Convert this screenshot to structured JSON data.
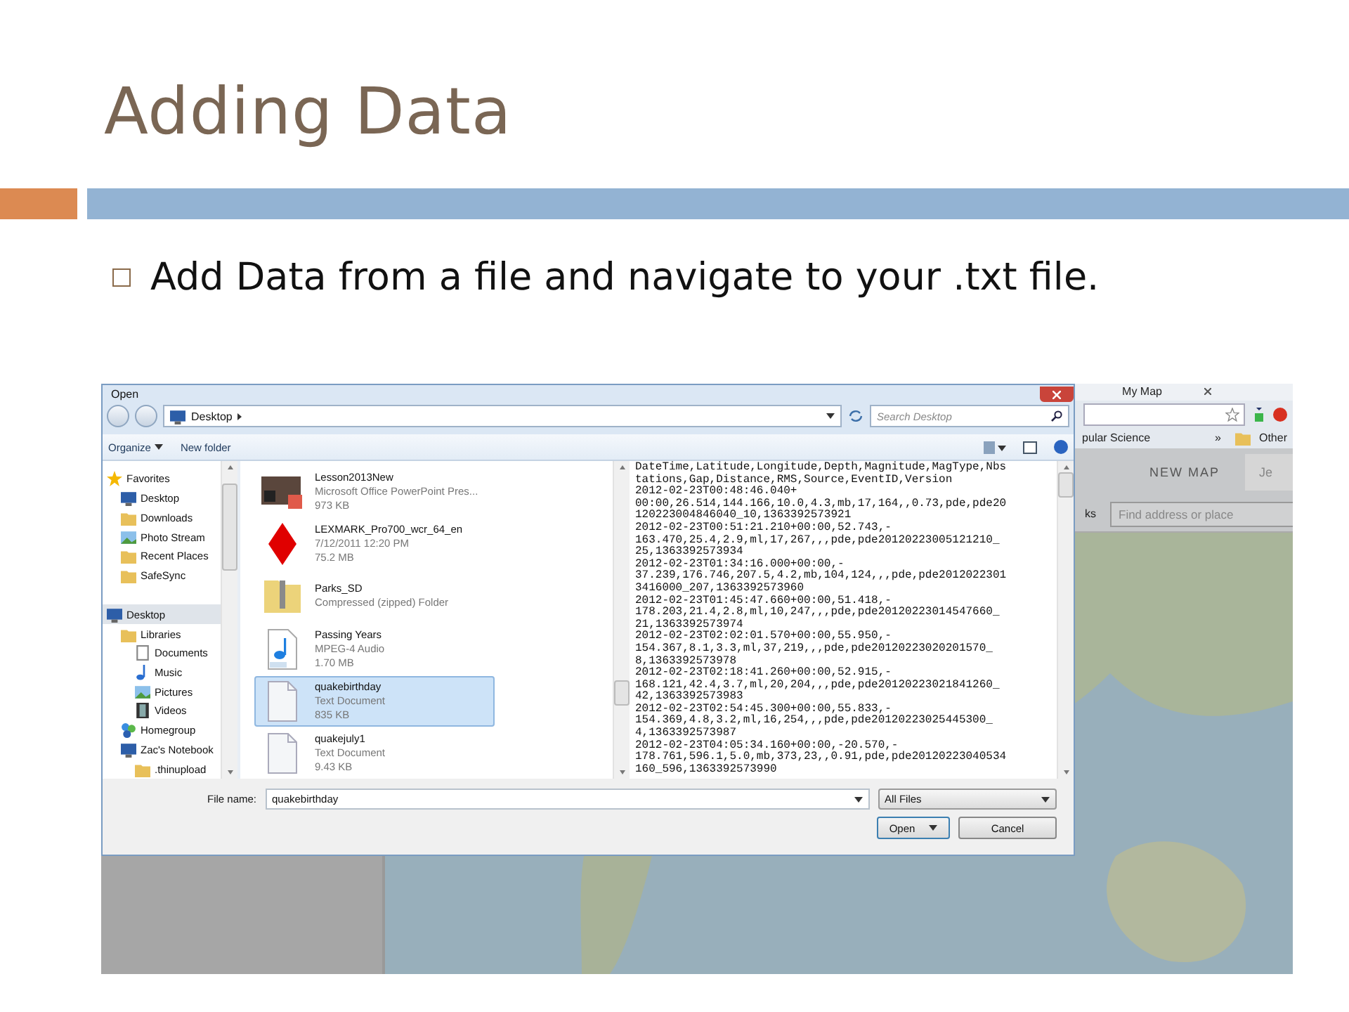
{
  "slide": {
    "title": "Adding Data",
    "bullet": "Add Data from a file and navigate to your .txt file."
  },
  "browser": {
    "tab_title": "My Map",
    "bookmarks": [
      {
        "label": "pular Science",
        "kind": "link"
      },
      {
        "label": "»",
        "kind": "more"
      },
      {
        "label": "Other",
        "kind": "folder"
      }
    ],
    "new_map": "NEW MAP",
    "user_tab": "Je",
    "nav_fragment": "ks",
    "search": {
      "placeholder": "Find address or place"
    }
  },
  "dialog": {
    "title": "Open",
    "breadcrumb": "Desktop",
    "search": {
      "placeholder": "Search Desktop"
    },
    "toolbar": [
      {
        "label": "Organize",
        "has_menu": true
      },
      {
        "label": "New folder",
        "has_menu": false
      }
    ],
    "nav": [
      {
        "label": "Favorites",
        "kind": "star",
        "selected": false,
        "children": [
          {
            "label": "Desktop",
            "kind": "monitor",
            "selected": false
          },
          {
            "label": "Downloads",
            "kind": "folder",
            "selected": false
          },
          {
            "label": "Photo Stream",
            "kind": "picture",
            "selected": false
          },
          {
            "label": "Recent Places",
            "kind": "folder",
            "selected": false
          },
          {
            "label": "SafeSync",
            "kind": "folder",
            "selected": false
          }
        ]
      },
      {
        "label": "Desktop",
        "kind": "monitor",
        "selected": true,
        "children": [
          {
            "label": "Libraries",
            "kind": "folder",
            "selected": false,
            "children": [
              {
                "label": "Documents",
                "kind": "document",
                "selected": false
              },
              {
                "label": "Music",
                "kind": "note",
                "selected": false
              },
              {
                "label": "Pictures",
                "kind": "picture",
                "selected": false
              },
              {
                "label": "Videos",
                "kind": "film",
                "selected": false
              }
            ]
          },
          {
            "label": "Homegroup",
            "kind": "people",
            "selected": false
          },
          {
            "label": "Zac's Notebook",
            "kind": "computer",
            "selected": false,
            "children": [
              {
                "label": ".thinupload",
                "kind": "folder",
                "selected": false
              }
            ]
          }
        ]
      }
    ],
    "files": [
      {
        "name": "Lesson2013New",
        "line2": "Microsoft Office PowerPoint Pres...",
        "line3": "973 KB",
        "kind": "slides",
        "selected": false
      },
      {
        "name": "LEXMARK_Pro700_wcr_64_en",
        "line2": "7/12/2011 12:20 PM",
        "line3": "75.2 MB",
        "kind": "diamond",
        "selected": false
      },
      {
        "name": "Parks_SD",
        "line2": "Compressed (zipped) Folder",
        "kind": "zip",
        "selected": false
      },
      {
        "name": "Passing Years",
        "line2": "MPEG-4 Audio",
        "line3": "1.70 MB",
        "kind": "audio",
        "selected": false
      },
      {
        "name": "quakebirthday",
        "line2": "Text Document",
        "line3": "835 KB",
        "kind": "text",
        "selected": true
      },
      {
        "name": "quakejuly1",
        "line2": "Text Document",
        "line3": "9.43 KB",
        "kind": "text",
        "selected": false
      }
    ],
    "preview": [
      "DateTime,Latitude,Longitude,Depth,Magnitude,MagType,Nbs",
      "tations,Gap,Distance,RMS,Source,EventID,Version",
      "2012-02-23T00:48:46.040+",
      "00:00,26.514,144.166,10.0,4.3,mb,17,164,,0.73,pde,pde20",
      "120223004846040_10,1363392573921",
      "2012-02-23T00:51:21.210+00:00,52.743,-",
      "163.470,25.4,2.9,ml,17,267,,,pde,pde20120223005121210_",
      "25,1363392573934",
      "2012-02-23T01:34:16.000+00:00,-",
      "37.239,176.746,207.5,4.2,mb,104,124,,,pde,pde2012022301",
      "3416000_207,1363392573960",
      "2012-02-23T01:45:47.660+00:00,51.418,-",
      "178.203,21.4,2.8,ml,10,247,,,pde,pde20120223014547660_",
      "21,1363392573974",
      "2012-02-23T02:02:01.570+00:00,55.950,-",
      "154.367,8.1,3.3,ml,37,219,,,pde,pde20120223020201570_",
      "8,1363392573978",
      "2012-02-23T02:18:41.260+00:00,52.915,-",
      "168.121,42.4,3.7,ml,20,204,,,pde,pde20120223021841260_",
      "42,1363392573983",
      "2012-02-23T02:54:45.300+00:00,55.833,-",
      "154.369,4.8,3.2,ml,16,254,,,pde,pde20120223025445300_",
      "4,1363392573987",
      "2012-02-23T04:05:34.160+00:00,-20.570,-",
      "178.761,596.1,5.0,mb,373,23,,0.91,pde,pde20120223040534",
      "160_596,1363392573990"
    ],
    "file_name_label": "File name:",
    "file_name": "quakebirthday",
    "filter": "All Files",
    "buttons": [
      {
        "label": "Open",
        "kind": "split"
      },
      {
        "label": "Cancel",
        "kind": "plain"
      }
    ]
  }
}
